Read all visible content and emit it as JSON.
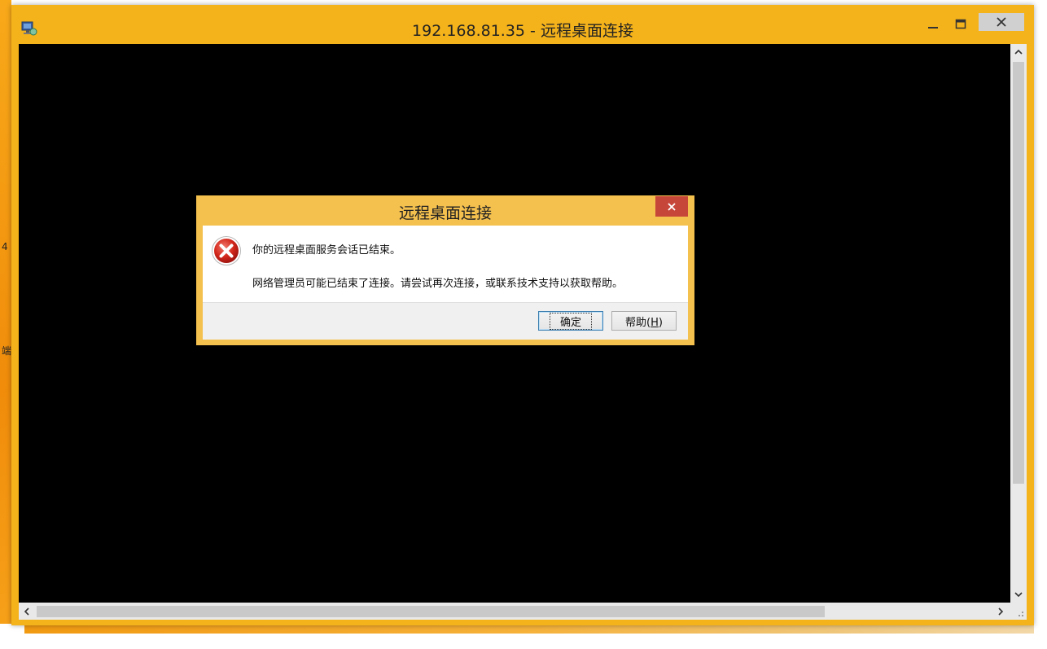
{
  "window": {
    "title": "192.168.81.35 - 远程桌面连接",
    "app_icon": "remote-desktop-icon",
    "controls": {
      "minimize": "minimize-icon",
      "maximize": "maximize-icon",
      "close": "close-icon"
    }
  },
  "desktop": {
    "labels": [
      "4",
      "端"
    ],
    "wallpaper_color": "#f4b21b"
  },
  "dialog": {
    "title": "远程桌面连接",
    "icon": "error-icon",
    "message": "你的远程桌面服务会话已结束。",
    "detail": "网络管理员可能已结束了连接。请尝试再次连接，或联系技术支持以获取帮助。",
    "buttons": {
      "ok_label": "确定",
      "help_label_prefix": "帮助(",
      "help_accesskey": "H",
      "help_label_suffix": ")"
    }
  },
  "colors": {
    "accent": "#f4b21b",
    "dialog_frame": "#f4c04e",
    "dialog_close": "#c7463a",
    "client_background": "#000000"
  }
}
